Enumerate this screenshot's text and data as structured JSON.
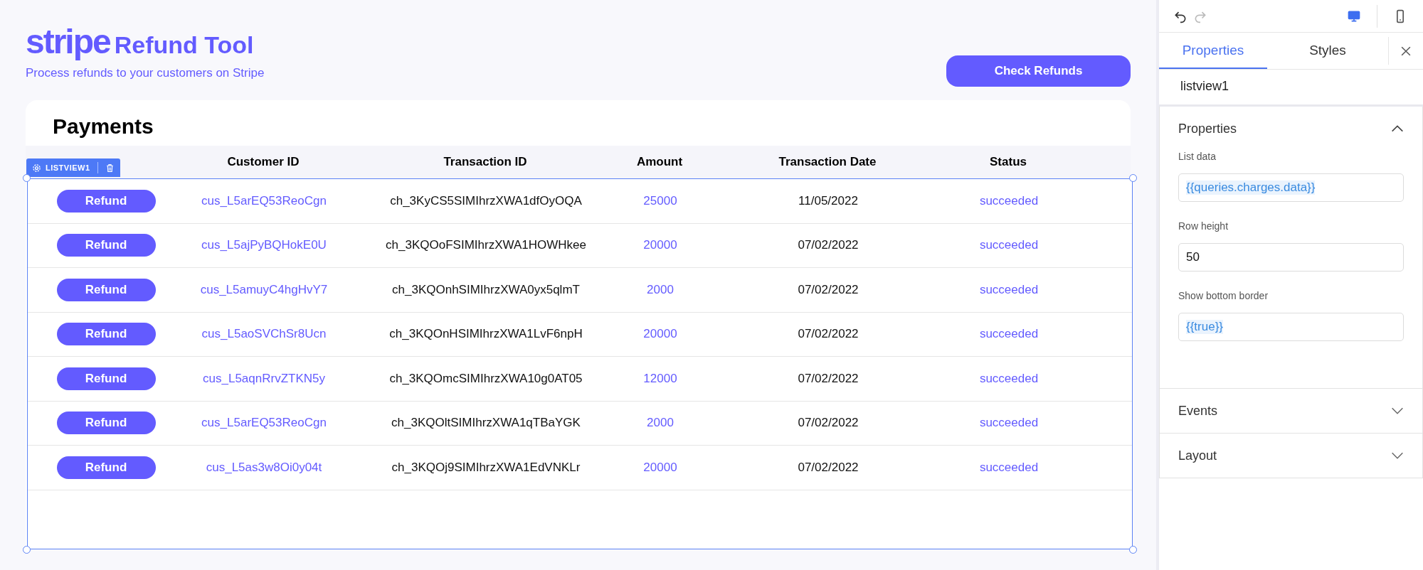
{
  "app": {
    "logo": "stripe",
    "title": "Refund Tool",
    "subtitle": "Process refunds to your customers on Stripe",
    "action_button": "Check Refunds"
  },
  "payments": {
    "title": "Payments",
    "columns": [
      "Customer ID",
      "Transaction ID",
      "Amount",
      "Transaction Date",
      "Status"
    ],
    "selection_label": "LISTVIEW1",
    "rows": [
      {
        "button": "Refund",
        "customer_id": "cus_L5arEQ53ReoCgn",
        "transaction_id": "ch_3KyCS5SIMIhrzXWA1dfOyOQA",
        "amount": "25000",
        "date": "11/05/2022",
        "status": "succeeded"
      },
      {
        "button": "Refund",
        "customer_id": "cus_L5ajPyBQHokE0U",
        "transaction_id": "ch_3KQOoFSIMIhrzXWA1HOWHkee",
        "amount": "20000",
        "date": "07/02/2022",
        "status": "succeeded"
      },
      {
        "button": "Refund",
        "customer_id": "cus_L5amuyC4hgHvY7",
        "transaction_id": "ch_3KQOnhSIMIhrzXWA0yx5qlmT",
        "amount": "2000",
        "date": "07/02/2022",
        "status": "succeeded"
      },
      {
        "button": "Refund",
        "customer_id": "cus_L5aoSVChSr8Ucn",
        "transaction_id": "ch_3KQOnHSIMIhrzXWA1LvF6npH",
        "amount": "20000",
        "date": "07/02/2022",
        "status": "succeeded"
      },
      {
        "button": "Refund",
        "customer_id": "cus_L5aqnRrvZTKN5y",
        "transaction_id": "ch_3KQOmcSIMIhrzXWA10g0AT05",
        "amount": "12000",
        "date": "07/02/2022",
        "status": "succeeded"
      },
      {
        "button": "Refund",
        "customer_id": "cus_L5arEQ53ReoCgn",
        "transaction_id": "ch_3KQOltSIMIhrzXWA1qTBaYGK",
        "amount": "2000",
        "date": "07/02/2022",
        "status": "succeeded"
      },
      {
        "button": "Refund",
        "customer_id": "cus_L5as3w8Oi0y04t",
        "transaction_id": "ch_3KQOj9SIMIhrzXWA1EdVNKLr",
        "amount": "20000",
        "date": "07/02/2022",
        "status": "succeeded"
      }
    ]
  },
  "inspector": {
    "history": [
      {
        "kind": "undo",
        "disabled": false
      },
      {
        "kind": "redo",
        "disabled": true
      }
    ],
    "devices": [
      {
        "kind": "desktop",
        "selected": true
      },
      {
        "kind": "mobile",
        "selected": false
      }
    ],
    "tabs": [
      {
        "label": "Properties",
        "selected": true
      },
      {
        "label": "Styles",
        "selected": false
      }
    ],
    "component_name": "listview1",
    "sections": [
      {
        "title": "Properties",
        "expanded": true,
        "fields": [
          {
            "label": "List data",
            "value": "{{queries.charges.data}}",
            "kind": "binding"
          },
          {
            "label": "Row height",
            "value": "50",
            "kind": "plain"
          },
          {
            "label": "Show bottom border",
            "value": "{{true}}",
            "kind": "binding"
          }
        ]
      },
      {
        "title": "Events",
        "expanded": false
      },
      {
        "title": "Layout",
        "expanded": false
      }
    ]
  }
}
